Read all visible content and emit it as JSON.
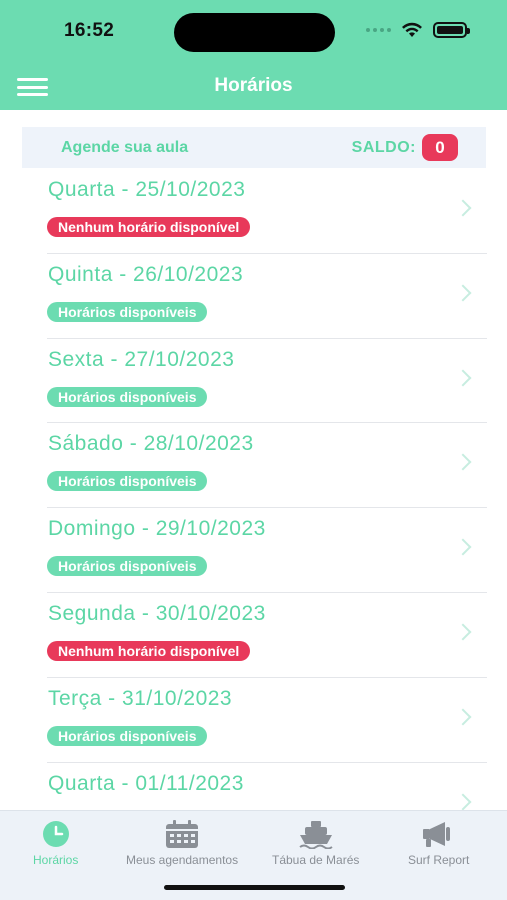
{
  "status_bar": {
    "time": "16:52"
  },
  "header": {
    "title": "Horários"
  },
  "info_bar": {
    "label": "Agende sua aula",
    "saldo_label": "SALDO:",
    "saldo_value": "0"
  },
  "days": [
    {
      "title": "Quarta - 25/10/2023",
      "status": "Nenhum horário disponível",
      "available": false
    },
    {
      "title": "Quinta - 26/10/2023",
      "status": "Horários disponíveis",
      "available": true
    },
    {
      "title": "Sexta - 27/10/2023",
      "status": "Horários disponíveis",
      "available": true
    },
    {
      "title": "Sábado - 28/10/2023",
      "status": "Horários disponíveis",
      "available": true
    },
    {
      "title": "Domingo - 29/10/2023",
      "status": "Horários disponíveis",
      "available": true
    },
    {
      "title": "Segunda - 30/10/2023",
      "status": "Nenhum horário disponível",
      "available": false
    },
    {
      "title": "Terça - 31/10/2023",
      "status": "Horários disponíveis",
      "available": true
    },
    {
      "title": "Quarta - 01/11/2023"
    }
  ],
  "tabs": [
    {
      "label": "Horários",
      "icon": "clock-icon",
      "active": true
    },
    {
      "label": "Meus agendamentos",
      "icon": "calendar-icon",
      "active": false
    },
    {
      "label": "Tábua de Marés",
      "icon": "boat-icon",
      "active": false
    },
    {
      "label": "Surf Report",
      "icon": "megaphone-icon",
      "active": false
    }
  ],
  "colors": {
    "primary": "#6cdcb1",
    "text_accent": "#5cd6a5",
    "danger": "#e8395a",
    "inactive": "#8a8f96"
  }
}
